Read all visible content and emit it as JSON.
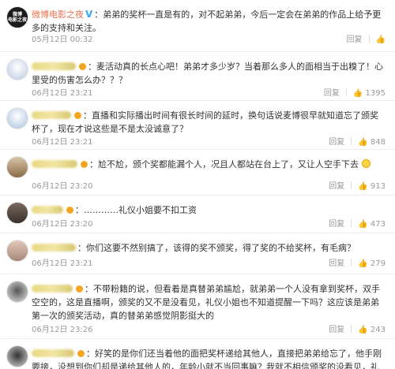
{
  "comments": [
    {
      "user": "微博电影之夜",
      "text": "弟弟的奖杯一直是有的，对不起弟弟，今后一定会在弟弟的作品上给予更多的支持和关注。",
      "time": "05月12日 00:32",
      "reply": "回复",
      "likes": "",
      "avatar_logo": "微博\n电影之夜",
      "avatar_colors": [
        "#1a1a1a",
        "#444444"
      ]
    },
    {
      "user": "",
      "text": "麦活动真的长点心吧！弟弟才多少岁？当着那么多人的面相当于出糗了！心里受的伤害怎么办？？？",
      "time": "06月12日 23:21",
      "reply": "回复",
      "likes": "1395",
      "avatar_colors": [
        "#e8f0fa",
        "#b8c8e0"
      ]
    },
    {
      "user": "",
      "text": "直播和实际播出时间有很长时间的延时，换句话说麦博很早就知道忘了颁奖杯了，现在才说这些是不是太没诚意了？",
      "time": "06月12日 23:21",
      "reply": "回复",
      "likes": "848",
      "avatar_colors": [
        "#eaf2fb",
        "#a9c0de"
      ]
    },
    {
      "user": "",
      "text": "尬不尬，颁个奖都能漏个人，况且人都站在台上了，又让人空手下去",
      "time": "06月12日 23:20",
      "reply": "回复",
      "likes": "913",
      "avatar_colors": [
        "#d9c6a8",
        "#8a6a48"
      ]
    },
    {
      "user": "",
      "text": "…………礼仪小姐要不扣工资",
      "time": "06月12日 23:20",
      "reply": "回复",
      "likes": "473",
      "avatar_colors": [
        "#7a6a60",
        "#3a302a"
      ]
    },
    {
      "user": "",
      "text": "你们这要不然别搞了，该得的奖不颁奖，得了奖的不给奖杯，有毛病？",
      "time": "06月12日 23:21",
      "reply": "回复",
      "likes": "279",
      "avatar_colors": [
        "#e0c8b8",
        "#a88878"
      ]
    },
    {
      "user": "",
      "text": "不带粉籍的说，但看着是真替弟弟尴尬，就弟弟一个人没有拿到奖杯，双手空空的，这是直播啊，颁奖的又不是没看见，礼仪小姐也不知道提醒一下吗？这应该是弟弟第一次的颁奖活动，真的替弟弟感觉阴影挺大的",
      "time": "06月12日 23:26",
      "reply": "回复",
      "likes": "243",
      "avatar_colors": [
        "#e8e8e8",
        "#555555"
      ]
    },
    {
      "user": "",
      "text": "好笑的是你们还当着他的面把奖杯递给其他人，直接把弟弟给忘了，他手刚要接，没想到你们却是递给其他人的，年龄小就不当回事嘛？我就不相信颁奖的没看见，礼仪小姐到底把奖杯拿下去了没有",
      "time": "",
      "reply": "",
      "likes": "",
      "avatar_colors": [
        "#d8d8d8",
        "#333333"
      ]
    }
  ]
}
